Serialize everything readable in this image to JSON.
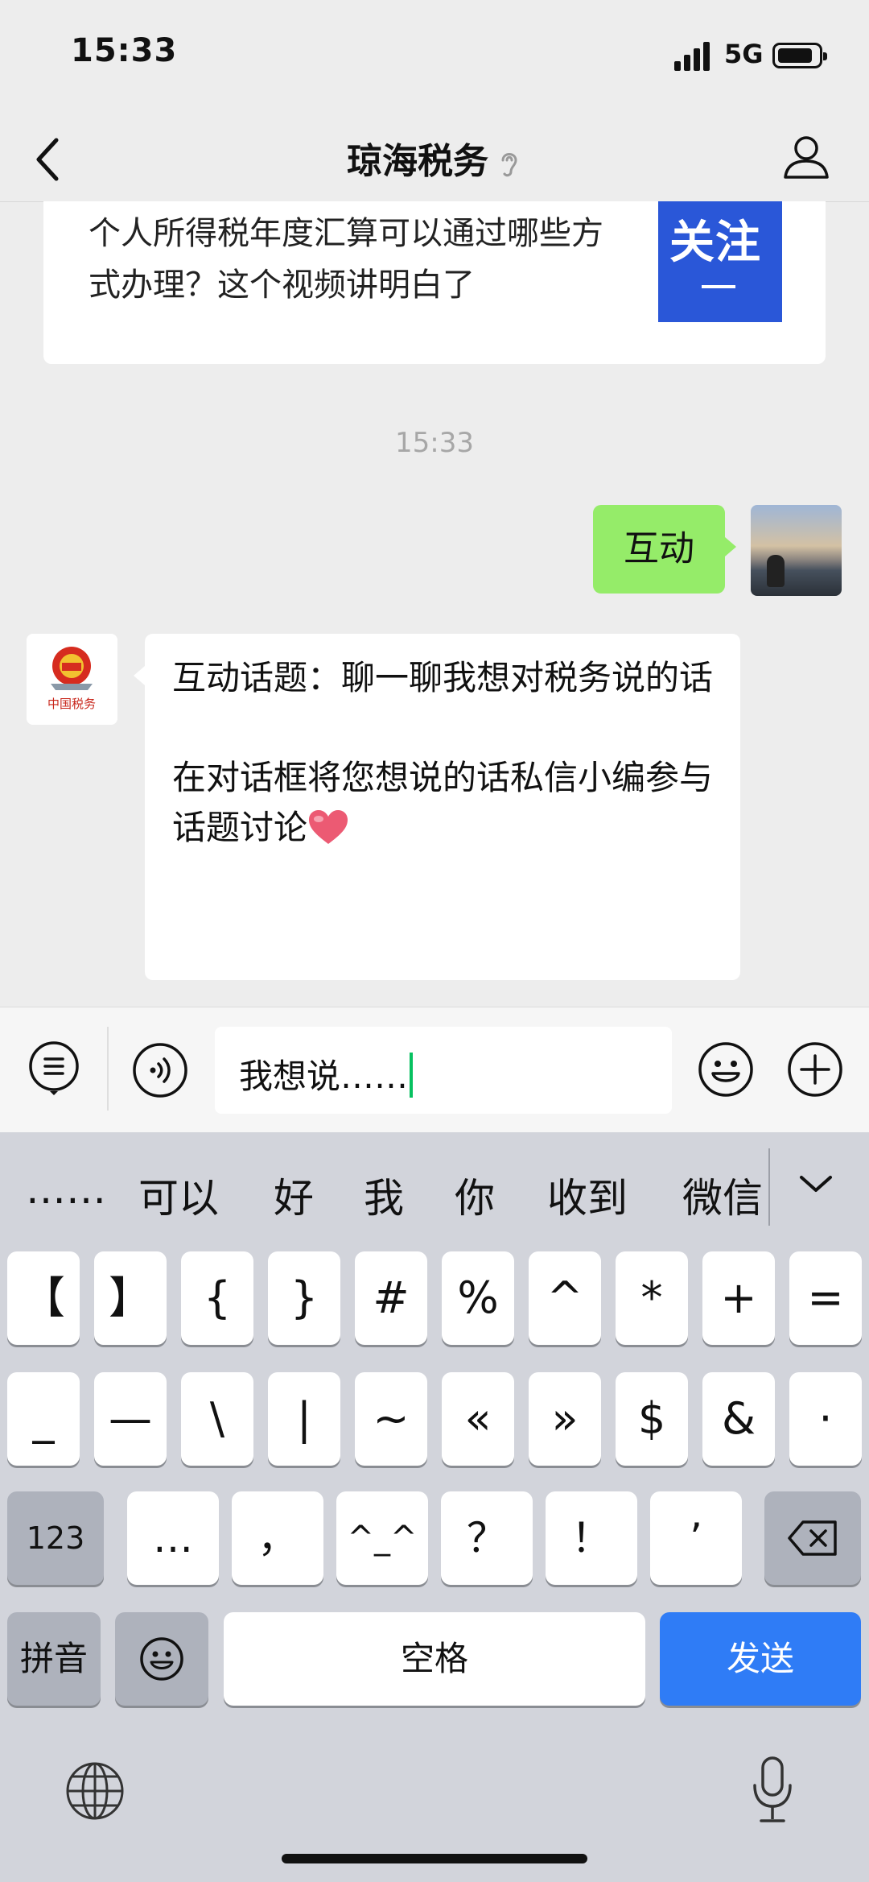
{
  "status": {
    "time": "15:33",
    "network": "5G"
  },
  "nav": {
    "title": "琼海税务"
  },
  "card": {
    "text": "个人所得税年度汇算可以通过哪些方式办理？这个视频讲明白了",
    "thumb_label": "关注"
  },
  "chat": {
    "timestamp": "15:33",
    "sent": "互动",
    "received_line1": "互动话题：聊一聊我想对税务说的话",
    "received_line2": "在对话框将您想说的话私信小编参与话题讨论"
  },
  "input": {
    "value": "我想说……"
  },
  "keyboard": {
    "candidates": [
      "……",
      "可以",
      "好",
      "我",
      "你",
      "收到",
      "微信"
    ],
    "row1": [
      "【",
      "】",
      "{",
      "}",
      "#",
      "%",
      "^",
      "*",
      "+",
      "="
    ],
    "row2": [
      "_",
      "—",
      "\\",
      "|",
      "~",
      "«",
      "»",
      "$",
      "&",
      "·"
    ],
    "row3": [
      "123",
      "…",
      "，",
      "^_^",
      "？",
      "！",
      "’"
    ],
    "row4": {
      "pinyin": "拼音",
      "space": "空格",
      "send": "发送"
    }
  },
  "colors": {
    "sent_bubble": "#95ec69",
    "send_key": "#2f7cf6",
    "caret": "#07c160"
  }
}
